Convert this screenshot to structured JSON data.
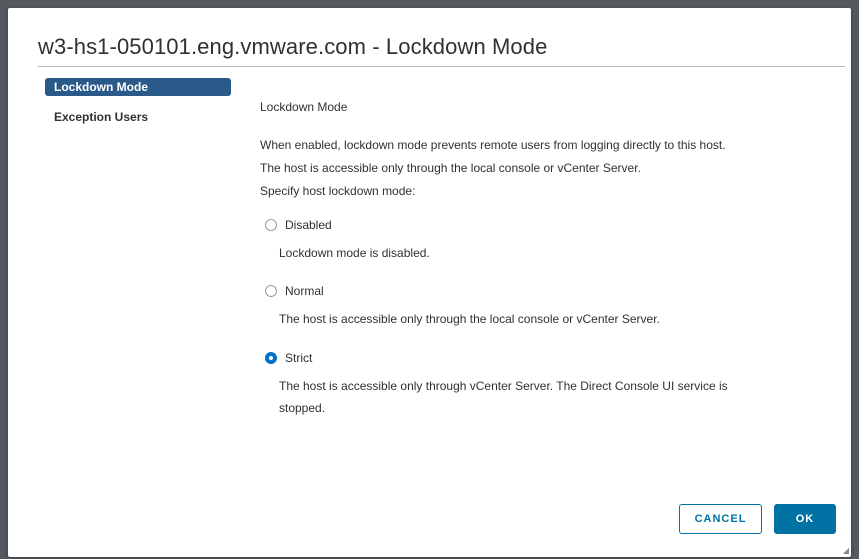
{
  "dialog": {
    "title": "w3-hs1-050101.eng.vmware.com - Lockdown Mode"
  },
  "sidebar": {
    "items": [
      {
        "label": "Lockdown Mode",
        "active": true
      },
      {
        "label": "Exception Users",
        "active": false
      }
    ]
  },
  "content": {
    "heading": "Lockdown Mode",
    "description_1": "When enabled, lockdown mode prevents remote users from logging directly to this host.",
    "description_2": "The host is accessible only through the local console or vCenter Server.",
    "prompt": "Specify host lockdown mode:",
    "options": [
      {
        "label": "Disabled",
        "checked": false,
        "desc": [
          "Lockdown mode is disabled."
        ]
      },
      {
        "label": "Normal",
        "checked": false,
        "desc": [
          "The host is accessible only through the local console or vCenter Server."
        ]
      },
      {
        "label": "Strict",
        "checked": true,
        "desc": [
          "The host is accessible only through vCenter Server. The Direct Console UI service is",
          "stopped."
        ]
      }
    ]
  },
  "footer": {
    "cancel_label": "CANCEL",
    "ok_label": "OK"
  },
  "colors": {
    "accent": "#0072a3",
    "nav_active": "#2a5a8a",
    "radio_checked": "#0072c6"
  }
}
